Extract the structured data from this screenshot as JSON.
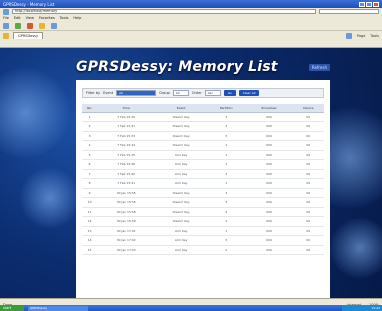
{
  "window": {
    "title": "GPRSDessy - Memory List"
  },
  "browser": {
    "address": "http://localhost/memory",
    "menu": [
      "File",
      "Edit",
      "View",
      "Favorites",
      "Tools",
      "Help"
    ],
    "tab_label": "GPRSDessy",
    "tools": [
      "Page",
      "Tools"
    ]
  },
  "app": {
    "title": "GPRSDessy: Memory List",
    "header_link": "Refresh"
  },
  "filter": {
    "label": "Filter by",
    "event_label": "Event",
    "event_value": "All",
    "group_label": "Group",
    "group_value": "All",
    "order_label": "Order",
    "order_value": "Asc",
    "go_label": "Go",
    "clear_label": "Clear All"
  },
  "table": {
    "headers": [
      "No.",
      "Time",
      "Event",
      "Partition",
      "Zone/User",
      "Device"
    ],
    "rows": [
      [
        "1",
        "7 Feb 15:30",
        "Disarm Key",
        "3",
        "000",
        "00"
      ],
      [
        "2",
        "7 Feb 15:31",
        "Disarm Key",
        "3",
        "000",
        "00"
      ],
      [
        "3",
        "7 Feb 15:33",
        "Disarm Key",
        "3",
        "000",
        "00"
      ],
      [
        "4",
        "7 Feb 15:34",
        "Disarm Key",
        "1",
        "000",
        "00"
      ],
      [
        "5",
        "7 Feb 15:35",
        "Arm Key",
        "1",
        "000",
        "00"
      ],
      [
        "6",
        "7 Feb 15:36",
        "Arm Key",
        "1",
        "000",
        "00"
      ],
      [
        "7",
        "7 Feb 15:40",
        "Arm Key",
        "3",
        "000",
        "00"
      ],
      [
        "8",
        "7 Feb 15:41",
        "Arm Key",
        "1",
        "000",
        "00"
      ],
      [
        "9",
        "30 Jan 15:55",
        "Disarm Key",
        "3",
        "000",
        "00"
      ],
      [
        "10",
        "30 Jan 15:56",
        "Disarm Key",
        "3",
        "000",
        "00"
      ],
      [
        "11",
        "30 Jan 15:58",
        "Disarm Key",
        "3",
        "000",
        "00"
      ],
      [
        "12",
        "30 Jan 15:59",
        "Disarm Key",
        "1",
        "000",
        "00"
      ],
      [
        "13",
        "30 Jan 17:01",
        "Arm Key",
        "1",
        "000",
        "00"
      ],
      [
        "14",
        "30 Jan 17:02",
        "Arm Key",
        "3",
        "000",
        "00"
      ],
      [
        "15",
        "30 Jan 17:03",
        "Arm Key",
        "2",
        "000",
        "00"
      ]
    ]
  },
  "status": {
    "left": "Done",
    "zone": "Internet",
    "zoom": "100%"
  },
  "taskbar": {
    "start": "start",
    "task": "GPRSDessy",
    "clock": "15:42"
  }
}
